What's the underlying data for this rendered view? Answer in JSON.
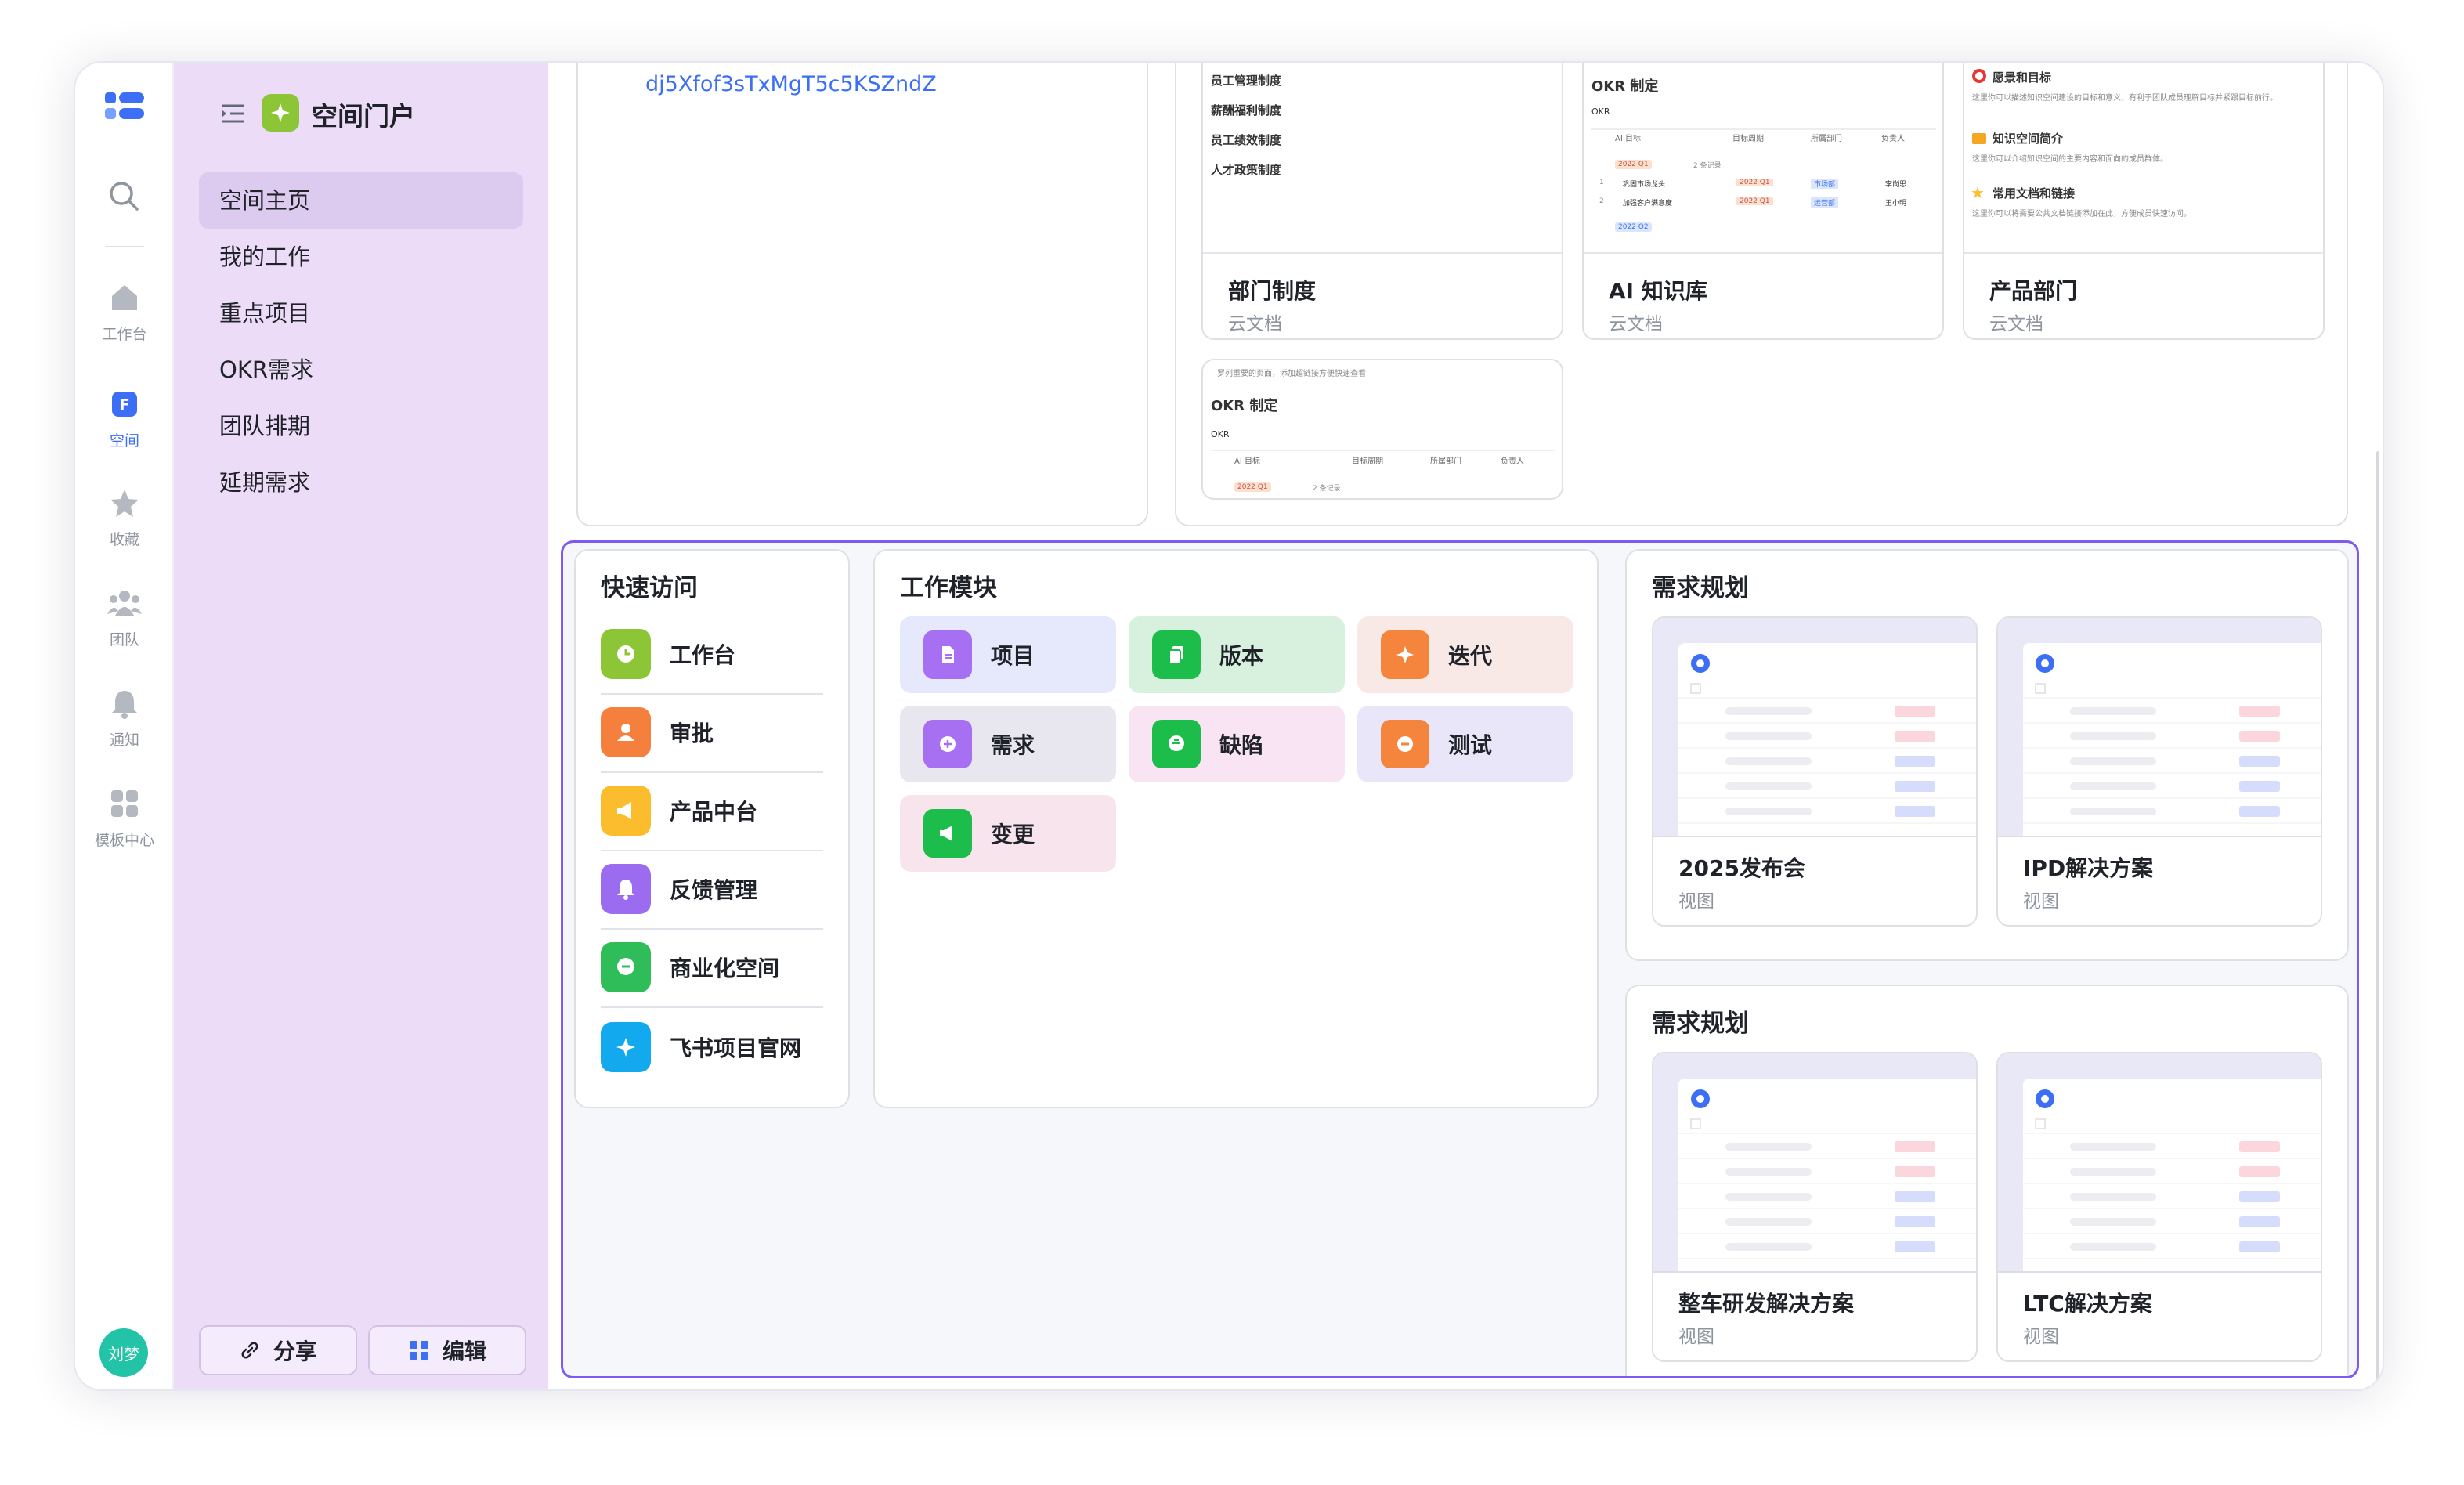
{
  "rail": {
    "search": "",
    "items": [
      {
        "label": "工作台"
      },
      {
        "label": "空间"
      },
      {
        "label": "收藏"
      },
      {
        "label": "团队"
      },
      {
        "label": "通知"
      },
      {
        "label": "模板中心"
      }
    ],
    "avatar": "刘梦"
  },
  "sidebar": {
    "title": "空间门户",
    "items": [
      {
        "label": "空间主页"
      },
      {
        "label": "我的工作"
      },
      {
        "label": "重点项目"
      },
      {
        "label": "OKR需求"
      },
      {
        "label": "团队排期"
      },
      {
        "label": "延期需求"
      }
    ],
    "share": "分享",
    "edit": "编辑"
  },
  "top": {
    "link": "dj5Xfof3sTxMgT5c5KSZndZ",
    "cards": [
      {
        "title": "部门制度",
        "sub": "云文档",
        "lines": [
          "员工管理制度",
          "薪酬福利制度",
          "员工绩效制度",
          "人才政策制度"
        ]
      },
      {
        "title": "AI 知识库",
        "sub": "云文档",
        "head": "OKR 制定",
        "okr": "OKR",
        "cols": [
          "AI 目标",
          "目标周期",
          "所属部门",
          "负责人"
        ],
        "q1": "2022 Q1",
        "q2": "2022 Q2",
        "rows": [
          {
            "n": "1",
            "t": "巩固市场龙头",
            "p": "2022 Q1",
            "d": "市场部",
            "o": "李尚思"
          },
          {
            "n": "2",
            "t": "加强客户满意度",
            "p": "2022 Q1",
            "d": "运营部",
            "o": "王小明"
          }
        ],
        "note": "2 条记录"
      },
      {
        "title": "产品部门",
        "sub": "云文档",
        "s1": "愿景和目标",
        "s1d": "这里你可以描述知识空间建设的目标和意义，有利于团队成员理解目标并紧跟目标前行。",
        "s2": "知识空间简介",
        "s2d": "这里你可以介绍知识空间的主要内容和面向的成员群体。",
        "s3": "常用文档和链接",
        "s3d": "这里你可以将需要公共文档链接添加在此，方便成员快速访问。"
      },
      {
        "note": "罗列重要的页面，添加超链接方便快速查看",
        "head": "OKR 制定",
        "okr": "OKR",
        "cols": [
          "AI 目标",
          "目标周期",
          "所属部门",
          "负责人"
        ],
        "q1": "2022 Q1",
        "rec": "2 条记录"
      }
    ]
  },
  "quick": {
    "title": "快速访问",
    "items": [
      {
        "label": "工作台",
        "color": "#8cc637"
      },
      {
        "label": "审批",
        "color": "#f5803e"
      },
      {
        "label": "产品中台",
        "color": "#fbbd2e"
      },
      {
        "label": "反馈管理",
        "color": "#9b6bf0"
      },
      {
        "label": "商业化空间",
        "color": "#2ebd59"
      },
      {
        "label": "飞书项目官网",
        "color": "#12a9ef"
      }
    ]
  },
  "modules": {
    "title": "工作模块",
    "items": [
      {
        "label": "项目",
        "bg": "#e6e8fc",
        "ic": "#a76ff2"
      },
      {
        "label": "版本",
        "bg": "#d7f1de",
        "ic": "#1dbd4b"
      },
      {
        "label": "迭代",
        "bg": "#f8e9e6",
        "ic": "#f5843d"
      },
      {
        "label": "需求",
        "bg": "#e8e7f0",
        "ic": "#a76ff2"
      },
      {
        "label": "缺陷",
        "bg": "#f8e4f2",
        "ic": "#1dbd4b"
      },
      {
        "label": "测试",
        "bg": "#e8e6f8",
        "ic": "#f5843d"
      },
      {
        "label": "变更",
        "bg": "#f8e4ec",
        "ic": "#1dbd4b"
      }
    ]
  },
  "plans": [
    {
      "title": "需求规划",
      "cards": [
        {
          "title": "2025发布会",
          "sub": "视图"
        },
        {
          "title": "IPD解决方案",
          "sub": "视图"
        }
      ]
    },
    {
      "title": "需求规划",
      "cards": [
        {
          "title": "整车研发解决方案",
          "sub": "视图"
        },
        {
          "title": "LTC解决方案",
          "sub": "视图"
        }
      ]
    }
  ],
  "colors": {
    "accent": "#3c6ff5",
    "selection": "#7f5af0",
    "sidebar": "#ecdcf8"
  }
}
